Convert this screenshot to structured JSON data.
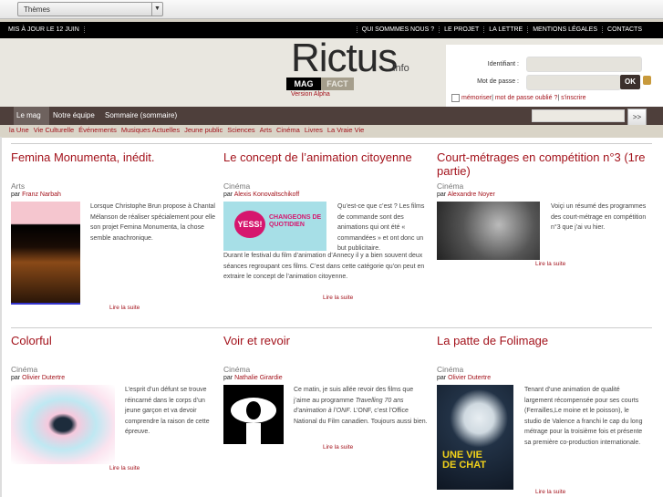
{
  "toolbar": {
    "theme_select": "Thèmes"
  },
  "topbar": {
    "updated": "MIS À JOUR LE 12 JUIN",
    "links": [
      "QUI SOMMMES NOUS ?",
      "LE PROJET",
      "LA LETTRE",
      "MENTIONS LÉGALES",
      "CONTACTS"
    ]
  },
  "logo": {
    "name": "Rictus",
    "tld": ".info",
    "mag": "MAG",
    "fact": "FACT",
    "version": "Version Alpha"
  },
  "login": {
    "id_label": "Identifiant :",
    "pw_label": "Mot de passe :",
    "ok": "OK",
    "remember": "mémoriser",
    "forgot": "mot de passe oublié ?",
    "signup": "s'inscrire",
    "sep": "|"
  },
  "nav": {
    "items": [
      "Le mag",
      "Notre équipe",
      "Sommaire (sommaire)"
    ],
    "search_button": ">>"
  },
  "categories": [
    "la Une",
    "Vie Culturelle",
    "Événements",
    "Musiques Actuelles",
    "Jeune public",
    "Sciences",
    "Arts",
    "Cinéma",
    "Livres",
    "La Vraie Vie"
  ],
  "by": "par",
  "more": "Lire la suite",
  "articles": [
    {
      "title": "Femina Monumenta, inédit.",
      "category": "Arts",
      "author": "Franz Narbah",
      "text": "Lorsque Christophe Brun propose à Chantal Mélanson de réaliser spécialement pour elle son projet Femina Monumenta, la chose semble anachronique."
    },
    {
      "title": "Le concept de l’animation citoyenne",
      "category": "Cinéma",
      "author": "Alexis Konovaltschikoff",
      "text": "Qu’est-ce que c’est ? Les films de commande sont des animations qui ont été « commandées » et ont donc un but publicitaire.",
      "text2": "Durant le festival du film d’animation d’Annecy il y a bien souvent deux séances regroupant ces films. C’est dans cette catégorie qu’on peut en extraire le concept de l’animation citoyenne.",
      "img_text1": "YESS!",
      "img_text2": "CHANGEONS DE QUOTIDIEN"
    },
    {
      "title": "Court-métrages en compétition n°3 (1re partie)",
      "category": "Cinéma",
      "author": "Alexandre Noyer",
      "text": "Voiçi un résumé des programmes des court-métrage en compétition n°3 que j’ai vu hier."
    },
    {
      "title": "Colorful",
      "category": "Cinéma",
      "author": "Olivier Dutertre",
      "text": "L’esprit d’un défunt se trouve réincarné dans le corps d’un jeune garçon et va devoir comprendre la raison de cette épreuve."
    },
    {
      "title": "Voir et revoir",
      "category": "Cinéma",
      "author": "Nathalie Girardie",
      "text_a": "Ce matin, je suis allée revoir des films que j’aime au programme ",
      "text_em": "Travelling 70 ans d’animation à l’ONF",
      "text_b": ". L’ONF, c’est l’Office National du Film canadien. Toujours aussi bien."
    },
    {
      "title": "La patte de Folimage",
      "category": "Cinéma",
      "author": "Olivier Dutertre",
      "text": "Tenant d’une animation de qualité largement récompensée pour ses courts (Ferrailles,Le moine et le poisson), le studio de Valence a franchi le cap du long métrage pour la troisième fois et présente sa première co-production internationale.",
      "img_text": "UNE VIE DE CHAT"
    }
  ]
}
